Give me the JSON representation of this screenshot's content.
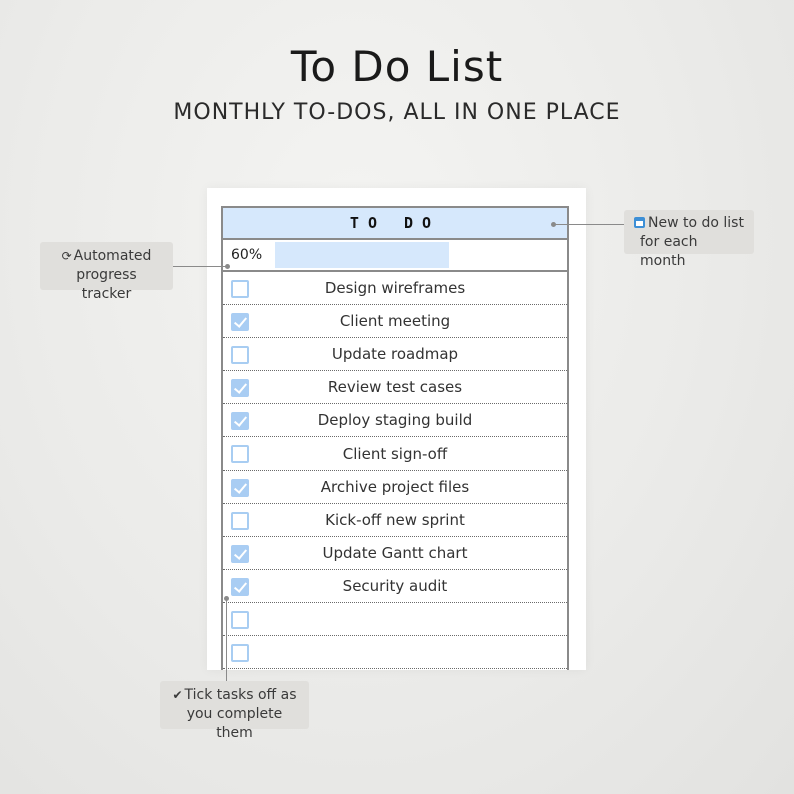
{
  "header": {
    "title": "To Do List",
    "subtitle": "MONTHLY TO-DOS, ALL IN ONE PLACE"
  },
  "sheet": {
    "heading": "TO DO",
    "progress_label": "60%",
    "progress_fraction": 0.6,
    "tasks": [
      {
        "label": "Design wireframes",
        "checked": false
      },
      {
        "label": "Client meeting",
        "checked": true
      },
      {
        "label": "Update roadmap",
        "checked": false
      },
      {
        "label": "Review test cases",
        "checked": true
      },
      {
        "label": "Deploy staging build",
        "checked": true
      },
      {
        "label": "Client sign-off",
        "checked": false
      },
      {
        "label": "Archive project files",
        "checked": true
      },
      {
        "label": "Kick-off new sprint",
        "checked": false
      },
      {
        "label": "Update Gantt chart",
        "checked": true
      },
      {
        "label": "Security audit",
        "checked": true
      },
      {
        "label": "",
        "checked": false
      },
      {
        "label": "",
        "checked": false
      }
    ]
  },
  "callouts": {
    "progress": {
      "icon": "refresh-icon",
      "line1": "Automated",
      "line2": "progress tracker"
    },
    "monthly": {
      "icon": "calendar-icon",
      "line1": "New to do list",
      "line2": "for each month"
    },
    "tick": {
      "icon": "checkmark-icon",
      "line1": "Tick tasks off as",
      "line2": "you complete them"
    }
  },
  "colors": {
    "accent": "#d6e8fc",
    "checkbox": "#a9cdf3",
    "border": "#8a8a8a"
  }
}
